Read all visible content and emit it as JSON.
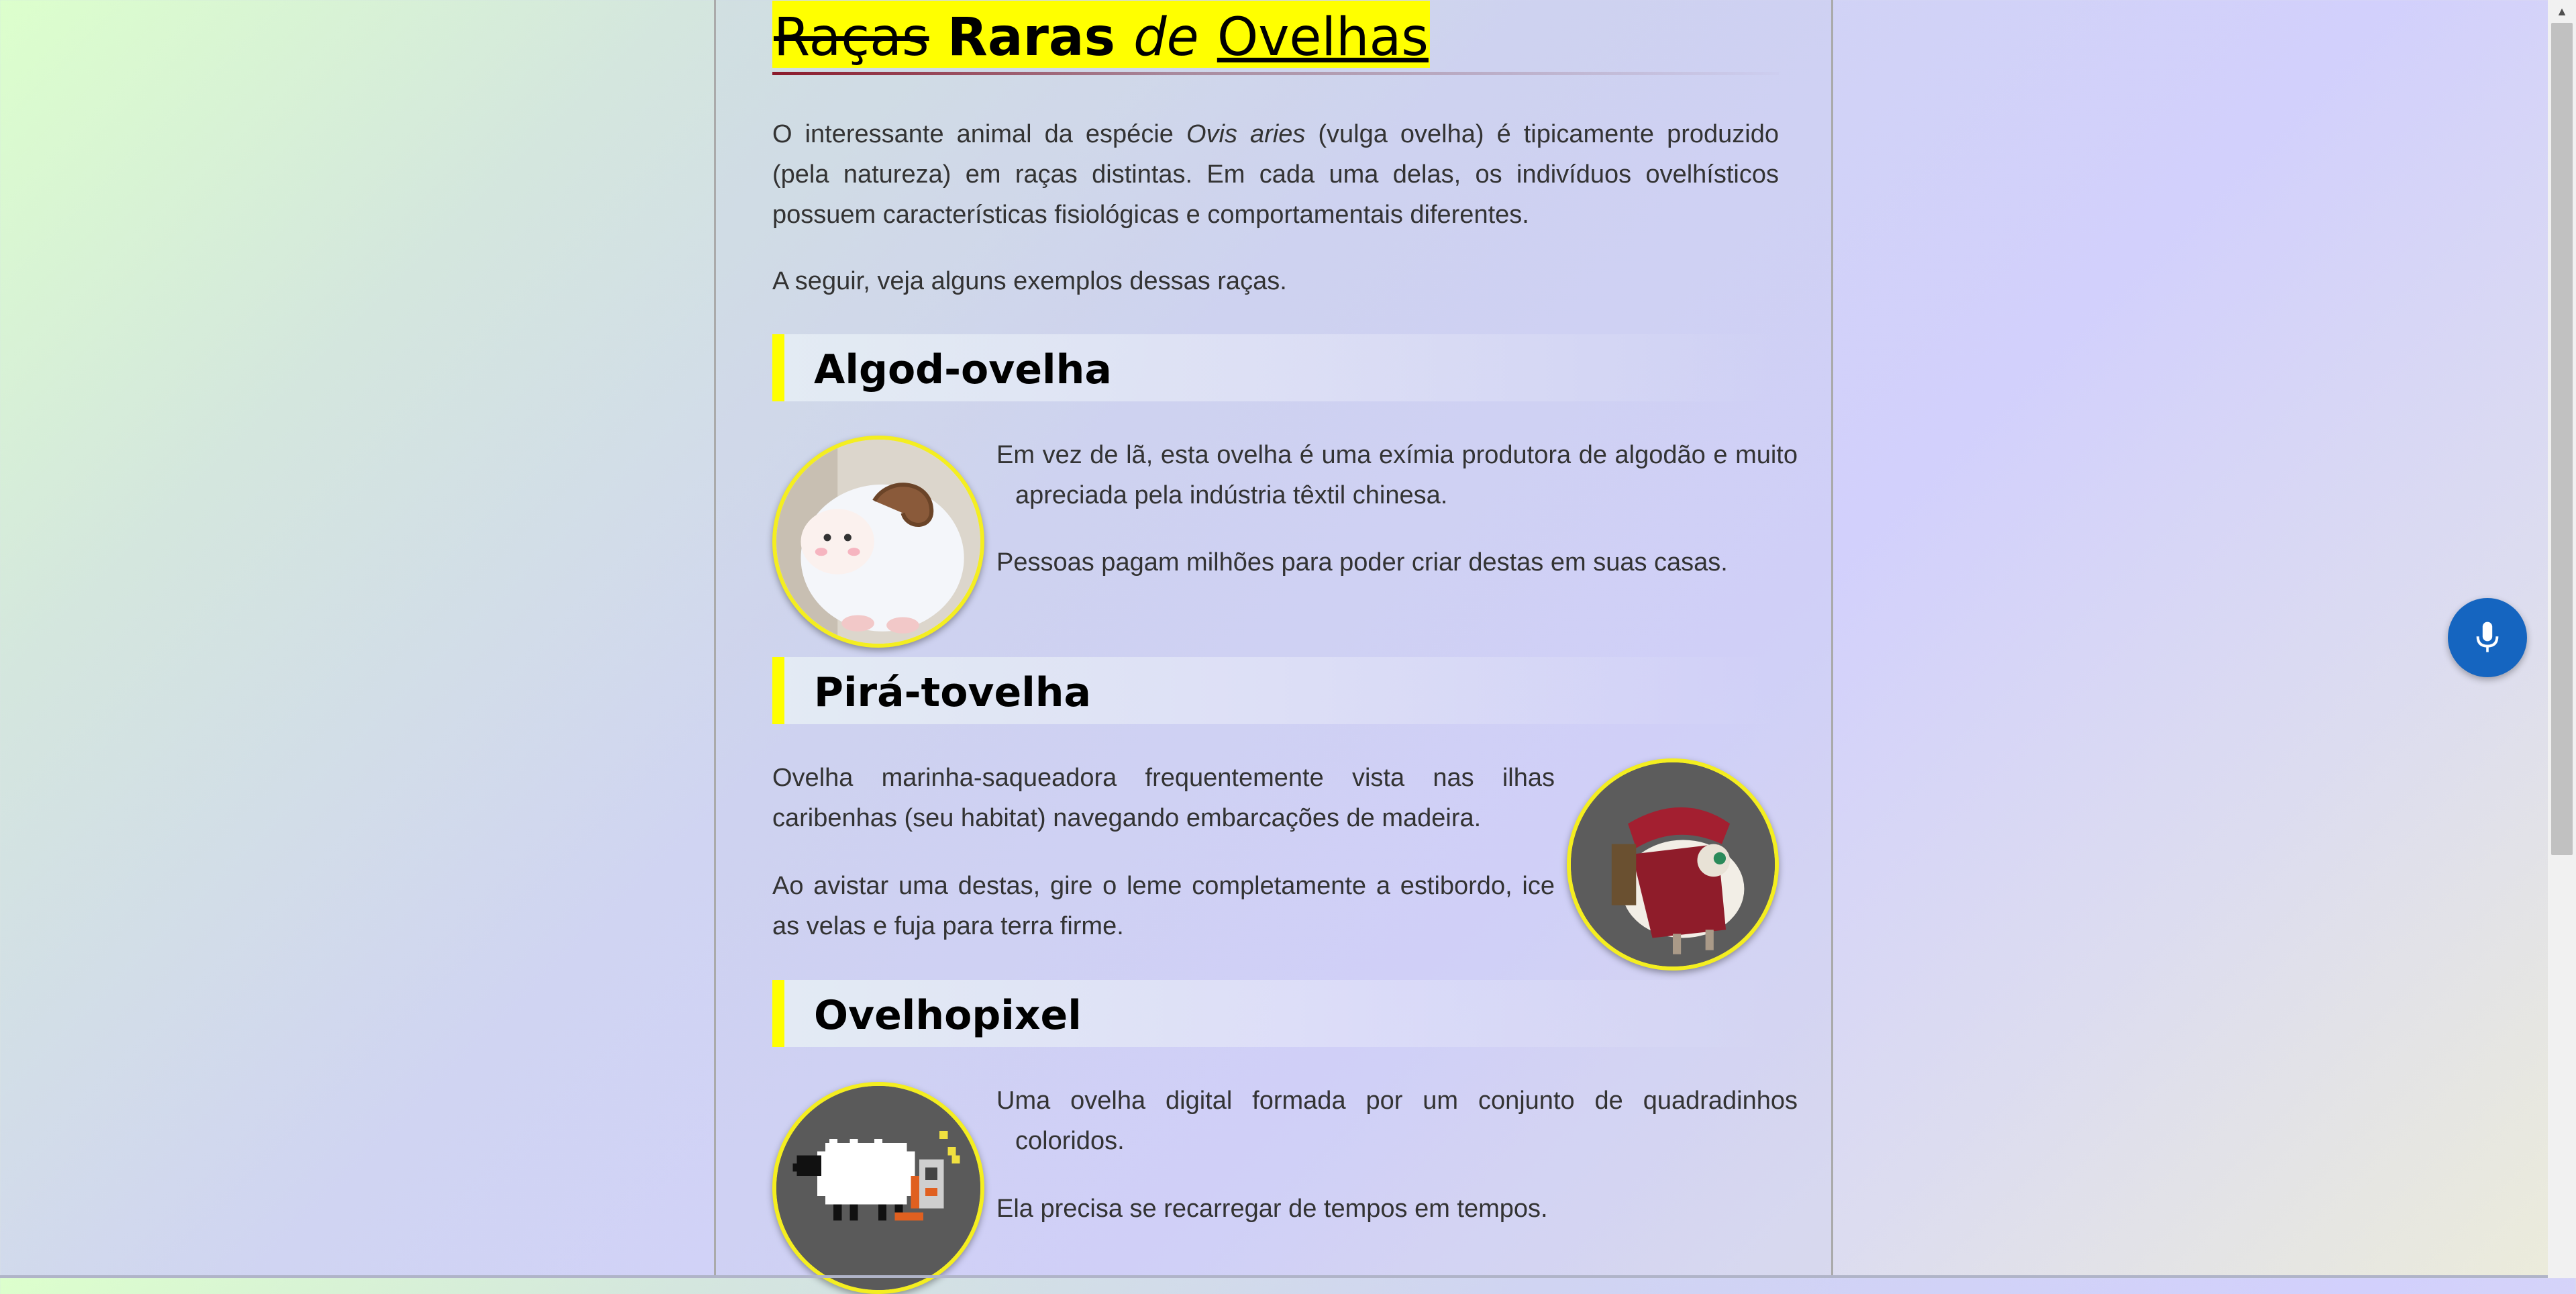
{
  "title": {
    "word1": "Raças",
    "word2": "Raras",
    "word3": "de",
    "word4": "Ovelhas"
  },
  "intro": {
    "p1_a": "O interessante animal da espécie ",
    "p1_species": "Ovis aries",
    "p1_b": " (vulga ovelha) é tipicamente produzido (pela natureza) em raças distintas. Em cada uma delas, os indivíduos ovelhísticos possuem características fisiológicas e comportamentais diferentes.",
    "p2": "A seguir, veja alguns exemplos dessas raças."
  },
  "breeds": [
    {
      "name": "Algod-ovelha",
      "p1": "Em vez de lã, esta ovelha é uma exímia produtora de algodão e muito apreciada pela indústria têxtil chinesa.",
      "p2": "Pessoas pagam milhões para poder criar destas em suas casas."
    },
    {
      "name": "Pirá-tovelha",
      "p1": "Ovelha marinha-saqueadora frequentemente vista nas ilhas caribenhas (seu habitat) navegando embarcações de madeira.",
      "p2": "Ao avistar uma destas, gire o leme completamente a estibordo, ice as velas e fuja para terra firme."
    },
    {
      "name": "Ovelhopixel",
      "p1": "Uma ovelha digital formada por um conjunto de quadradinhos coloridos.",
      "p2": "Ela precisa se recarregar de tempos em tempos."
    }
  ],
  "mic": {
    "icon": "microphone-icon"
  },
  "colors": {
    "highlight": "#ffff00",
    "accent_blue": "#1565c0",
    "text": "#333333"
  }
}
